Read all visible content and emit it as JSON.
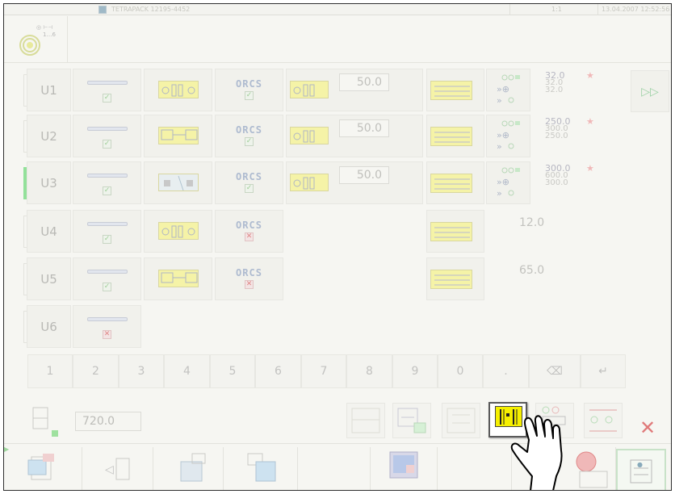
{
  "titlebar": {
    "title": "TETRAPACK 12195-4452",
    "page": "1:1",
    "datetime": "13.04.2007 12:52:56"
  },
  "units": [
    {
      "label": "U1",
      "shaft_ok": true,
      "tool": "slot-tool",
      "orcs": "ORCS",
      "orcs_ok": true,
      "length": "50.0",
      "has_speed": true,
      "values": [
        "32.0",
        "32.0",
        "32.0"
      ],
      "star": true
    },
    {
      "label": "U2",
      "shaft_ok": true,
      "tool": "hash-tool",
      "orcs": "ORCS",
      "orcs_ok": true,
      "length": "50.0",
      "has_speed": true,
      "values": [
        "250.0",
        "300.0",
        "250.0"
      ],
      "star": true
    },
    {
      "label": "U3",
      "shaft_ok": true,
      "tool": "gray-tool",
      "orcs": "ORCS",
      "orcs_ok": true,
      "length": "50.0",
      "has_speed": true,
      "values": [
        "300.0",
        "600.0",
        "300.0"
      ],
      "star": true,
      "active": true
    },
    {
      "label": "U4",
      "shaft_ok": true,
      "tool": "slot-tool",
      "orcs": "ORCS",
      "orcs_ok": false,
      "scheme_value": "12.0"
    },
    {
      "label": "U5",
      "shaft_ok": true,
      "tool": "hash-tool",
      "orcs": "ORCS",
      "orcs_ok": false,
      "scheme_value": "65.0"
    },
    {
      "label": "U6",
      "shaft_ok": false
    }
  ],
  "keypad": {
    "keys": [
      "1",
      "2",
      "3",
      "4",
      "5",
      "6",
      "7",
      "8",
      "9",
      "0",
      "."
    ]
  },
  "total": {
    "value": "720.0"
  },
  "colors": {
    "accent_yellow": "#f6f000",
    "ok_green": "#9fce98",
    "error_red": "#e07a7a",
    "active_unit": "#93e19a"
  }
}
